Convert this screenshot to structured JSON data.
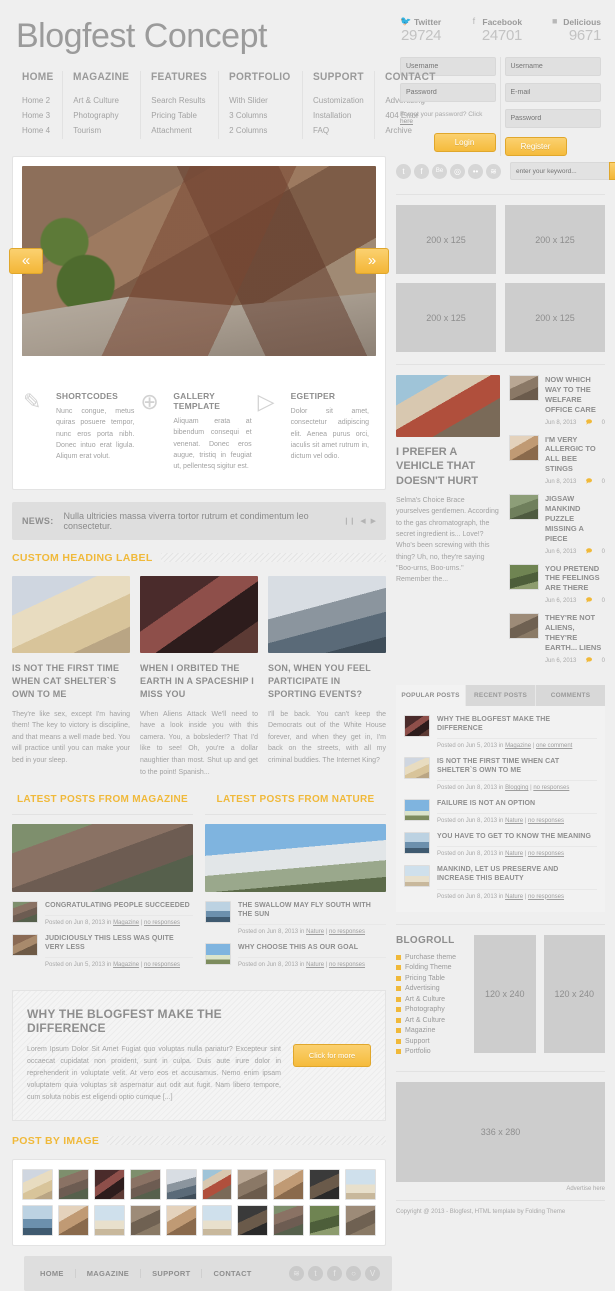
{
  "site": {
    "title": "Blogfest Concept"
  },
  "menu": [
    {
      "top": "HOME",
      "sub": [
        "Home 2",
        "Home 3",
        "Home 4"
      ]
    },
    {
      "top": "MAGAZINE",
      "sub": [
        "Art & Culture",
        "Photography",
        "Tourism"
      ]
    },
    {
      "top": "FEATURES",
      "sub": [
        "Search Results",
        "Pricing Table",
        "Attachment"
      ]
    },
    {
      "top": "PORTFOLIO",
      "sub": [
        "With Slider",
        "3 Columns",
        "2 Columns"
      ]
    },
    {
      "top": "SUPPORT",
      "sub": [
        "Customization",
        "Installation",
        "FAQ"
      ]
    },
    {
      "top": "CONTACT",
      "sub": [
        "Advertising",
        "404 Error",
        "Archive"
      ]
    }
  ],
  "social_stats": [
    {
      "icon": "twitter-icon",
      "name": "Twitter",
      "count": "29724"
    },
    {
      "icon": "facebook-icon",
      "name": "Facebook",
      "count": "24701"
    },
    {
      "icon": "delicious-icon",
      "name": "Delicious",
      "count": "9671"
    }
  ],
  "login": {
    "username_placeholder": "Username",
    "password_placeholder": "Password",
    "forgot_text": "Forgot your password? Click ",
    "forgot_link": "here",
    "button": "Login"
  },
  "register": {
    "username_placeholder": "Username",
    "email_placeholder": "E-mail",
    "password_placeholder": "Password",
    "button": "Register"
  },
  "slider": {
    "prev": "«",
    "next": "»"
  },
  "shortcodes": [
    {
      "icon": "note-pencil-icon",
      "title": "SHORTCODES",
      "text": "Nunc congue, metus quiras posuere tempor, nunc eros porta nibh. Donec intuo erat ligula. Aliqum erat volut."
    },
    {
      "icon": "globe-cursor-icon",
      "title": "GALLERY TEMPLATE",
      "text": "Aliquam erata at bibendum consequi et venenat. Donec eros augue, tristiq in feugiat ut, pellentesq sigitur est."
    },
    {
      "icon": "megaphone-icon",
      "title": "EGETIPER",
      "text": "Dolor sit amet, consectetur adipiscing elit. Aenea purus orci, iaculis sit amet rutrum in, dictum vel odio."
    }
  ],
  "news": {
    "label": "NEWS:",
    "text": "Nulla ultricies massa viverra tortor rutrum et condimentum leo consectetur.",
    "controls": [
      "pause-icon",
      "prev-icon",
      "next-icon"
    ]
  },
  "custom_heading": "CUSTOM HEADING LABEL",
  "trio": [
    {
      "img": "ph-food",
      "title": "IS NOT THE FIRST TIME WHEN CAT SHELTER`S OWN TO ME",
      "text": "They're like sex, except I'm having them! The key to victory is discipline, and that means a well made bed. You will practice until you can make your bed in your sleep."
    },
    {
      "img": "ph-cam",
      "title": "WHEN I ORBITED THE EARTH IN A SPACESHIP I MISS YOU",
      "text": "When Aliens Attack We'll need to have a look inside you with this camera. You, a bobsleder!? That I'd like to see! Oh, you're a dollar naughtier than most. Shut up and get to the point! Spanish..."
    },
    {
      "img": "ph-boat",
      "title": "SON, WHEN YOU FEEL PARTICIPATE IN SPORTING EVENTS?",
      "text": "I'll be back. You can't keep the Democrats out of the White House forever, and when they get in, I'm back on the streets, with all my criminal buddies. The Internet King?"
    }
  ],
  "latest": [
    {
      "heading": "LATEST POSTS FROM MAGAZINE",
      "hero": "ph-town",
      "posts": [
        {
          "thumb": "ph-town",
          "title": "CONGRATULATING PEOPLE SUCCEEDED",
          "meta_pre": "Posted on Jun 8, 2013 in ",
          "cat": "Magazine",
          "sep": " | ",
          "resp": "no responses"
        },
        {
          "thumb": "ph-roof",
          "title": "JUDICIOUSLY THIS LESS WAS QUITE VERY LESS",
          "meta_pre": "Posted on Jun 5, 2013 in ",
          "cat": "Magazine",
          "sep": " | ",
          "resp": "no responses"
        }
      ]
    },
    {
      "heading": "LATEST POSTS FROM NATURE",
      "hero": "ph-bridge",
      "posts": [
        {
          "thumb": "ph-sea",
          "title": "THE SWALLOW MAY FLY SOUTH WITH THE SUN",
          "meta_pre": "Posted on Jun 8, 2013 in ",
          "cat": "Nature",
          "sep": " | ",
          "resp": "no responses"
        },
        {
          "thumb": "ph-sky",
          "title": "WHY CHOOSE THIS AS OUR GOAL",
          "meta_pre": "Posted on Jun 8, 2013 in ",
          "cat": "Nature",
          "sep": " | ",
          "resp": "no responses"
        }
      ]
    }
  ],
  "cta": {
    "title": "WHY THE BLOGFEST MAKE THE DIFFERENCE",
    "text": "Lorem Ipsum Dolor Sit Amet Fugiat quo voluptas nulla pariatur? Excepteur sint occaecat cupidatat non proident, sunt in culpa. Duis aute irure dolor in reprehenderit in voluptate velit. At vero eos et accusamus. Nemo enim ipsam voluptatem quia voluptas sit aspernatur aut odit aut fugit. Nam libero tempore, cum soluta nobis est eligendi optio cumque [...]",
    "button": "Click for more"
  },
  "post_by_image": "POST BY IMAGE",
  "thumb_grid": [
    "ph-food",
    "ph-town",
    "ph-cam",
    "ph-town",
    "ph-boat",
    "ph-vase",
    "ph-old",
    "ph-girl",
    "ph-dark",
    "ph-beach",
    "ph-sea",
    "ph-girl",
    "ph-beach",
    "ph-house",
    "ph-girl",
    "ph-beach",
    "ph-dark",
    "ph-town",
    "ph-heli",
    "ph-house"
  ],
  "sidebar": {
    "social_icons": [
      "twitter-icon",
      "facebook-icon",
      "behance-icon",
      "instagram-icon",
      "flickr-icon",
      "rss-icon"
    ],
    "search_placeholder": "enter your keyword...",
    "search_icon": "search-icon",
    "ads_200": [
      "200 x 125",
      "200 x 125",
      "200 x 125",
      "200 x 125"
    ],
    "featured": {
      "img": "ph-vase",
      "title": "I PREFER A VEHICLE THAT DOESN'T HURT",
      "text": "Selma's Choice Brace yourselves gentlemen. According to the gas chromatograph, the secret ingredient is... Love!? Who's been screwing with this thing? Uh, no, they're saying \"Boo-urns, Boo-urns.\" Remember the..."
    },
    "news_items": [
      {
        "thumb": "ph-old",
        "title": "NOW WHICH WAY TO THE WELFARE OFFICE CARE",
        "date": "Jun 8, 2013",
        "comments": "0"
      },
      {
        "thumb": "ph-girl",
        "title": "I'M VERY ALLERGIC TO ALL BEE STINGS",
        "date": "Jun 8, 2013",
        "comments": "0"
      },
      {
        "thumb": "ph-puzz",
        "title": "JIGSAW MANKIND PUZZLE MISSING A PIECE",
        "date": "Jun 6, 2013",
        "comments": "0"
      },
      {
        "thumb": "ph-heli",
        "title": "YOU PRETEND THE FEELINGS ARE THERE",
        "date": "Jun 6, 2013",
        "comments": "0"
      },
      {
        "thumb": "ph-house",
        "title": "THEY'RE NOT ALIENS, THEY'RE EARTH... LIENS",
        "date": "Jun 6, 2013",
        "comments": "0"
      }
    ],
    "tabs": [
      {
        "label": "POPULAR POSTS",
        "active": true
      },
      {
        "label": "RECENT POSTS",
        "active": false
      },
      {
        "label": "COMMENTS",
        "active": false
      }
    ],
    "popular_posts": [
      {
        "thumb": "ph-cam",
        "title": "WHY THE BLOGFEST MAKE THE DIFFERENCE",
        "meta_pre": "Posted on Jun 5, 2013 in ",
        "cat": "Magazine",
        "sep": " | ",
        "resp": "one comment"
      },
      {
        "thumb": "ph-food",
        "title": "IS NOT THE FIRST TIME WHEN CAT SHELTER`S OWN TO ME",
        "meta_pre": "Posted on Jun 8, 2013 in ",
        "cat": "Blogging",
        "sep": " | ",
        "resp": "no responses"
      },
      {
        "thumb": "ph-sky",
        "title": "FAILURE IS NOT AN OPTION",
        "meta_pre": "Posted on Jun 8, 2013 in ",
        "cat": "Nature",
        "sep": " | ",
        "resp": "no responses"
      },
      {
        "thumb": "ph-sea",
        "title": "YOU HAVE TO GET TO KNOW THE MEANING",
        "meta_pre": "Posted on Jun 8, 2013 in ",
        "cat": "Nature",
        "sep": " | ",
        "resp": "no responses"
      },
      {
        "thumb": "ph-beach",
        "title": "MANKIND, LET US PRESERVE AND INCREASE THIS BEAUTY",
        "meta_pre": "Posted on Jun 8, 2013 in ",
        "cat": "Nature",
        "sep": " | ",
        "resp": "no responses"
      }
    ],
    "blogroll": {
      "title": "BLOGROLL",
      "items": [
        "Purchase theme",
        "Folding Theme",
        "Pricing Table",
        "Advertising",
        "Art & Culture",
        "Photography",
        "Art & Culture",
        "Magazine",
        "Support",
        "Portfolio"
      ]
    },
    "ads_120": [
      "120 x 240",
      "120 x 240"
    ],
    "ad_336": "336 x 280",
    "advertise_here": "Advertise here",
    "copyright": "Copyright @ 2013 - Blogfest, HTML template by Folding Theme"
  },
  "footer": {
    "nav": [
      "HOME",
      "MAGAZINE",
      "SUPPORT",
      "CONTACT"
    ],
    "social": [
      "rss-icon",
      "twitter-icon",
      "facebook-icon",
      "dribbble-icon",
      "vimeo-icon"
    ]
  },
  "colors": {
    "accent": "#f0b93a",
    "page_bg": "#efefef",
    "text": "#8a8a8a"
  }
}
